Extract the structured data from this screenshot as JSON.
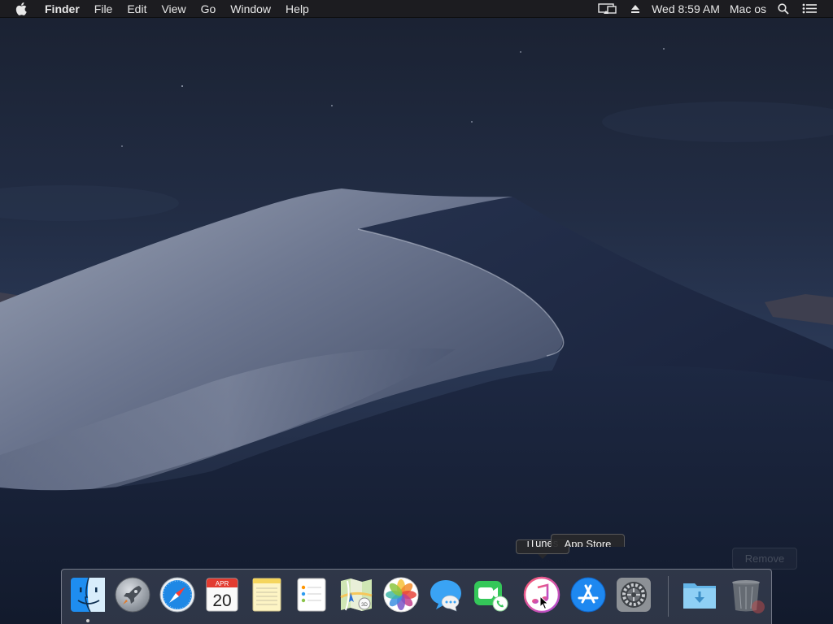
{
  "menubar": {
    "app_name": "Finder",
    "menus": [
      "File",
      "Edit",
      "View",
      "Go",
      "Window",
      "Help"
    ],
    "clock": "Wed 8:59 AM",
    "user": "Mac os",
    "icons": {
      "apple": "apple-logo-icon",
      "display": "airplay-display-icon",
      "eject": "eject-icon",
      "search": "spotlight-search-icon",
      "notifications": "notification-center-icon"
    }
  },
  "tooltips": {
    "itunes": "iTunes",
    "app_store": "App Store",
    "remove": "Remove"
  },
  "calendar": {
    "month": "APR",
    "day": "20"
  },
  "dock": {
    "apps": [
      {
        "name": "Finder",
        "icon": "finder-icon",
        "running": true
      },
      {
        "name": "Launchpad",
        "icon": "launchpad-icon"
      },
      {
        "name": "Safari",
        "icon": "safari-icon"
      },
      {
        "name": "Calendar",
        "icon": "calendar-icon"
      },
      {
        "name": "Notes",
        "icon": "notes-icon"
      },
      {
        "name": "Reminders",
        "icon": "reminders-icon"
      },
      {
        "name": "Maps",
        "icon": "maps-icon"
      },
      {
        "name": "Photos",
        "icon": "photos-icon"
      },
      {
        "name": "Messages",
        "icon": "messages-icon"
      },
      {
        "name": "FaceTime",
        "icon": "facetime-icon"
      },
      {
        "name": "iTunes",
        "icon": "itunes-icon"
      },
      {
        "name": "App Store",
        "icon": "app-store-icon"
      },
      {
        "name": "System Preferences",
        "icon": "system-preferences-icon"
      },
      {
        "name": "Downloads",
        "icon": "downloads-folder-icon"
      },
      {
        "name": "Trash",
        "icon": "trash-icon"
      }
    ]
  },
  "colors": {
    "menubar_bg": "#1c1c1e",
    "sky_top": "#1b2233",
    "dune_light": "#8a93a8",
    "dune_shadow": "#1e2a44"
  }
}
